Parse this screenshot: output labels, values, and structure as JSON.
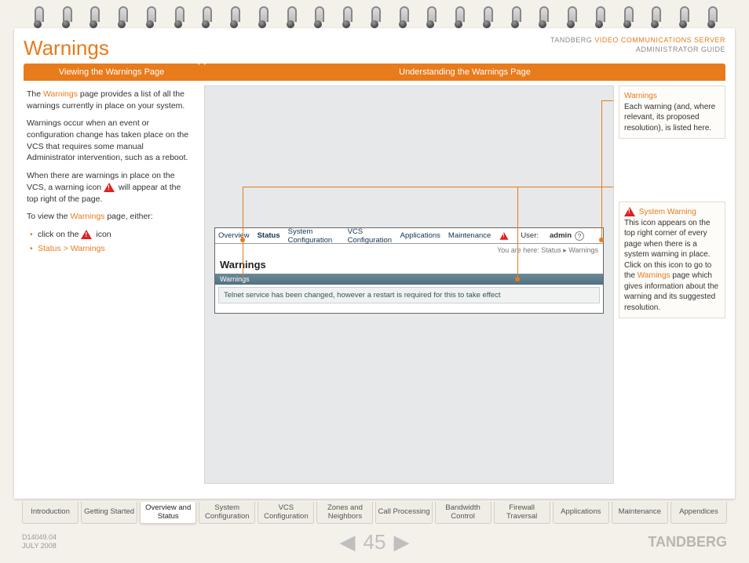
{
  "header": {
    "page_title": "Warnings",
    "brand_prefix": "TANDBERG",
    "brand_product": "VIDEO COMMUNICATIONS SERVER",
    "brand_sub": "ADMINISTRATOR GUIDE"
  },
  "tabs": {
    "left": "Viewing the Warnings Page",
    "right": "Understanding the Warnings Page"
  },
  "left_col": {
    "p1a": "The ",
    "p1b": "Warnings",
    "p1c": " page provides a list of all the warnings currently in place on your system.",
    "p2": "Warnings occur when an event or configuration change has taken place on the VCS that requires some manual Administrator intervention, such as a reboot.",
    "p3a": "When there are warnings in place on the VCS, a warning icon ",
    "p3b": " will appear at the top right of the page.",
    "p4a": "To view the ",
    "p4b": "Warnings",
    "p4c": " page, either:",
    "li1a": "click on the ",
    "li1b": " icon",
    "li2": "Status > Warnings"
  },
  "screenshot": {
    "tabs": [
      "Overview",
      "Status",
      "System Configuration",
      "VCS Configuration",
      "Applications",
      "Maintenance"
    ],
    "user_label": "User:",
    "user_value": "admin",
    "breadcrumb": "You are here: Status ▸ Warnings",
    "title": "Warnings",
    "panel_header": "Warnings",
    "row": "Telnet service has been changed, however a restart is required for this to take effect"
  },
  "right_col": {
    "c1_title": "Warnings",
    "c1_body": "Each warning (and, where relevant, its proposed resolution), is listed here.",
    "c2_title": "System Warning",
    "c2_a": "This icon appears on the top right corner of every page when there is a system warning in place. Click on this icon to go to the ",
    "c2_link": "Warnings",
    "c2_b": " page which gives information about the warning and its suggested resolution."
  },
  "bottom_tabs": [
    "Introduction",
    "Getting Started",
    "Overview and Status",
    "System Configuration",
    "VCS Configuration",
    "Zones and Neighbors",
    "Call Processing",
    "Bandwidth Control",
    "Firewall Traversal",
    "Applications",
    "Maintenance",
    "Appendices"
  ],
  "bottom_active_index": 2,
  "footer": {
    "doc_id": "D14049.04",
    "doc_date": "JULY 2008",
    "page_number": "45",
    "brand": "TANDBERG"
  }
}
